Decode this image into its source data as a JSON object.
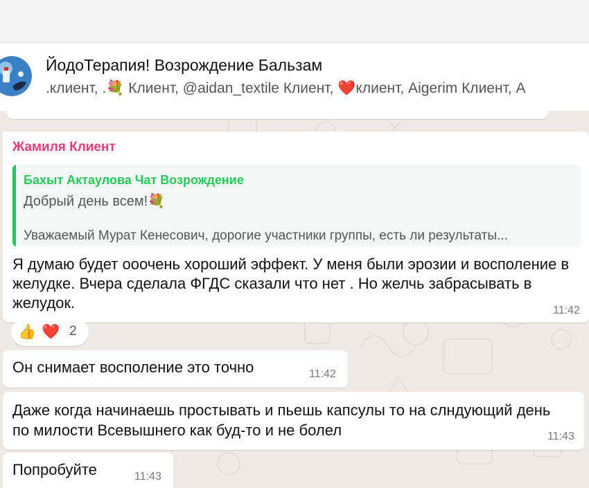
{
  "header": {
    "title": "ЙодоТерапия! Возрождение Бальзам",
    "members": ".клиент, .💐 Клиент, @aidan_textile Клиент, ❤️клиент, Aigerim Клиент, A"
  },
  "colors": {
    "sender_name": "#e63b7a",
    "quote_accent": "#25c95b",
    "chat_background": "#eeeae3",
    "bubble": "#ffffff"
  },
  "messages": [
    {
      "sender": "Жамиля Клиент",
      "quote": {
        "author": "Бахыт Актаулова Чат Возрождение",
        "line1": "Добрый день всем!💐",
        "line2": "Уважаемый Мурат Кенесович, дорогие участники группы, есть ли результаты..."
      },
      "text": "Я думаю будет ооочень хороший эффект. У меня были эрозии и восполение в желудке. Вчера сделала ФГДС сказали что нет . Но желчь забрасывать в желудок.",
      "time": "11:42",
      "reactions": {
        "emoji1": "👍",
        "emoji2": "❤️",
        "count": "2"
      }
    },
    {
      "text": "Он снимает восполение это точно",
      "time": "11:42"
    },
    {
      "text": "Даже когда начинаешь простывать и пьешь капсулы то на слндующий день по милости Всевышнего как буд-то и не болел",
      "time": "11:43"
    },
    {
      "text": "Попробуйте",
      "time": "11:43"
    }
  ]
}
